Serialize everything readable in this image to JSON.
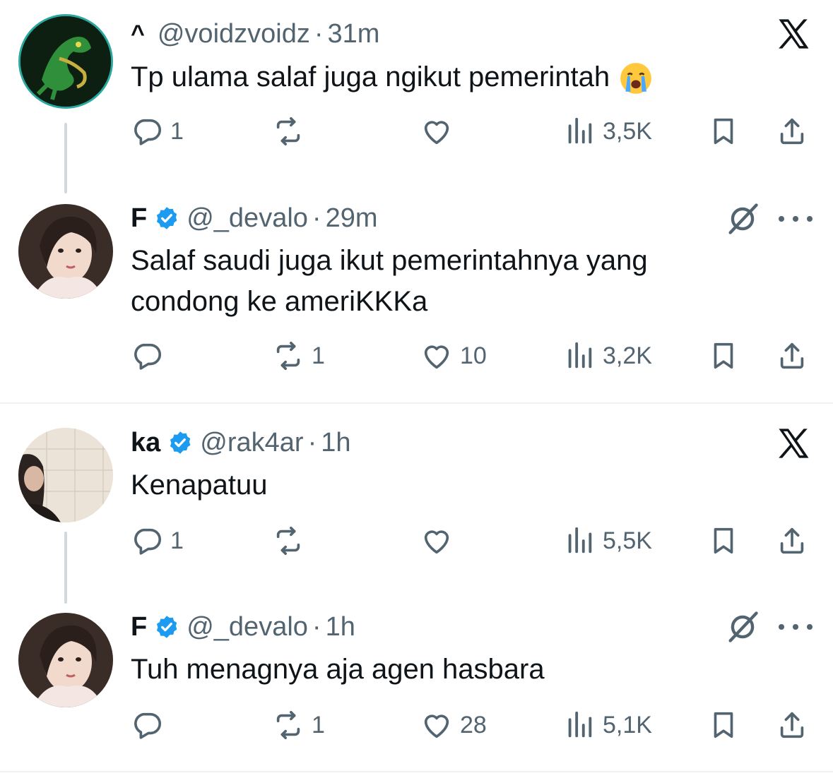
{
  "threads": [
    {
      "tweets": [
        {
          "caret": "^",
          "name": "",
          "verified": false,
          "handle": "@voidzvoidz",
          "separator": "·",
          "time": "31m",
          "text": "Tp ulama salaf juga ngikut pemerintah",
          "emoji": "loudly-crying-face",
          "replies": "1",
          "reposts": "",
          "likes": "",
          "views": "3,5K",
          "corner_icon": "x-logo-icon"
        },
        {
          "caret": "",
          "name": "F",
          "verified": true,
          "handle": "@_devalo",
          "separator": "·",
          "time": "29m",
          "text_lines": [
            "Salaf saudi juga ikut pemerintahnya yang",
            "condong ke ameriKKKa"
          ],
          "replies": "",
          "reposts": "1",
          "likes": "10",
          "views": "3,2K",
          "corner_icon": "grok-icon"
        }
      ]
    },
    {
      "tweets": [
        {
          "caret": "",
          "name": "ka",
          "verified": true,
          "handle": "@rak4ar",
          "separator": "·",
          "time": "1h",
          "text": "Kenapatuu",
          "replies": "1",
          "reposts": "",
          "likes": "",
          "views": "5,5K",
          "corner_icon": "x-logo-icon"
        },
        {
          "caret": "",
          "name": "F",
          "verified": true,
          "handle": "@_devalo",
          "separator": "·",
          "time": "1h",
          "text": "Tuh menagnya aja agen hasbara",
          "replies": "",
          "reposts": "1",
          "likes": "28",
          "views": "5,1K",
          "corner_icon": "grok-icon"
        }
      ]
    }
  ],
  "colors": {
    "text": "#0f1419",
    "secondary": "#536471",
    "verified": "#1d9bf0",
    "thread_line": "#cfd9de",
    "divider": "#eff3f4"
  }
}
